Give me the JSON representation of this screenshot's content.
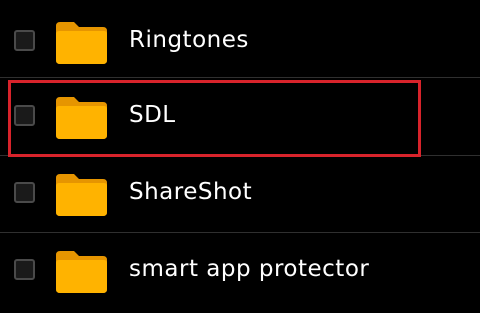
{
  "colors": {
    "background": "#000000",
    "highlight": "#d7232b",
    "folder": "#ffb300",
    "text": "#ffffff"
  },
  "items": [
    {
      "label": "Ringtones",
      "icon": "folder-icon",
      "checked": false
    },
    {
      "label": "SDL",
      "icon": "folder-icon",
      "checked": false,
      "highlighted": true
    },
    {
      "label": "ShareShot",
      "icon": "folder-icon",
      "checked": false
    },
    {
      "label": "smart app protector",
      "icon": "folder-icon",
      "checked": false
    }
  ]
}
